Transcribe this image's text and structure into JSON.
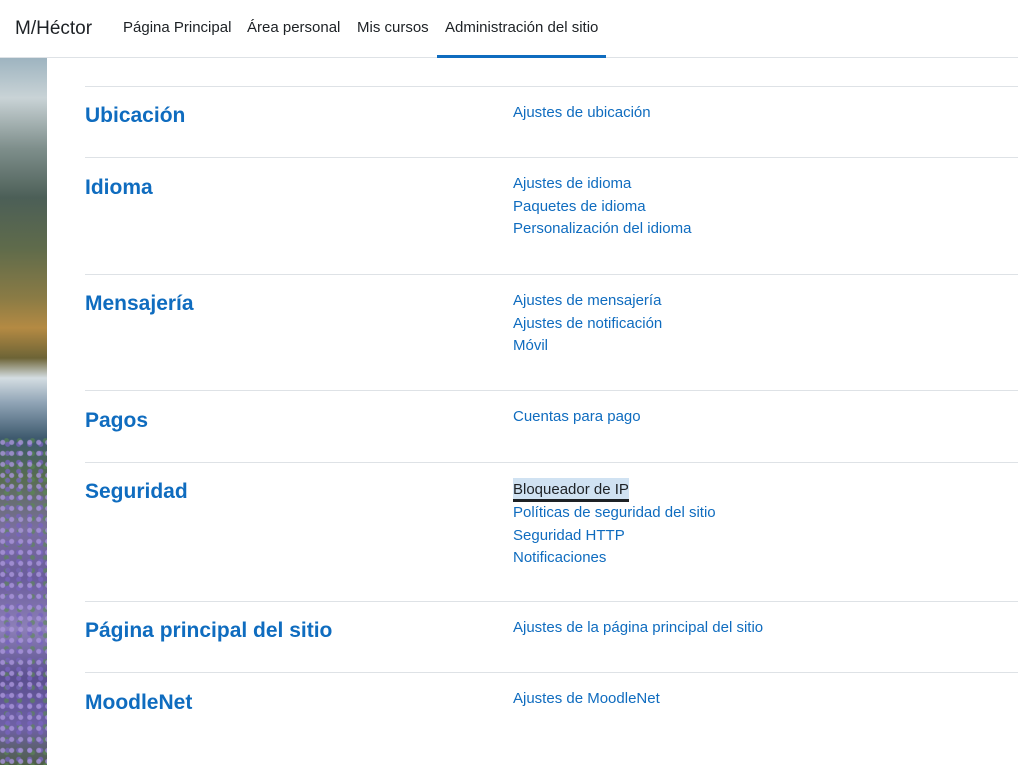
{
  "navbar": {
    "brand": "M/Héctor",
    "tabs": [
      {
        "label": "Página Principal"
      },
      {
        "label": "Área personal"
      },
      {
        "label": "Mis cursos"
      },
      {
        "label": "Administración del sitio"
      }
    ],
    "active_tab": "Administración del sitio"
  },
  "sections": [
    {
      "title": "Ubicación",
      "links": [
        "Ajustes de ubicación"
      ]
    },
    {
      "title": "Idioma",
      "links": [
        "Ajustes de idioma",
        "Paquetes de idioma",
        "Personalización del idioma"
      ]
    },
    {
      "title": "Mensajería",
      "links": [
        "Ajustes de mensajería",
        "Ajustes de notificación",
        "Móvil"
      ]
    },
    {
      "title": "Pagos",
      "links": [
        "Cuentas para pago"
      ]
    },
    {
      "title": "Seguridad",
      "links": [
        "Bloqueador de IP",
        "Políticas de seguridad del sitio",
        "Seguridad HTTP",
        "Notificaciones"
      ]
    },
    {
      "title": "Página principal del sitio",
      "links": [
        "Ajustes de la página principal del sitio"
      ]
    },
    {
      "title": "MoodleNet",
      "links": [
        "Ajustes de MoodleNet"
      ]
    }
  ],
  "focused_link": "Bloqueador de IP",
  "colors": {
    "link": "#0f6cbf",
    "text": "#1d2125",
    "focus_background": "#d0e2f2"
  }
}
